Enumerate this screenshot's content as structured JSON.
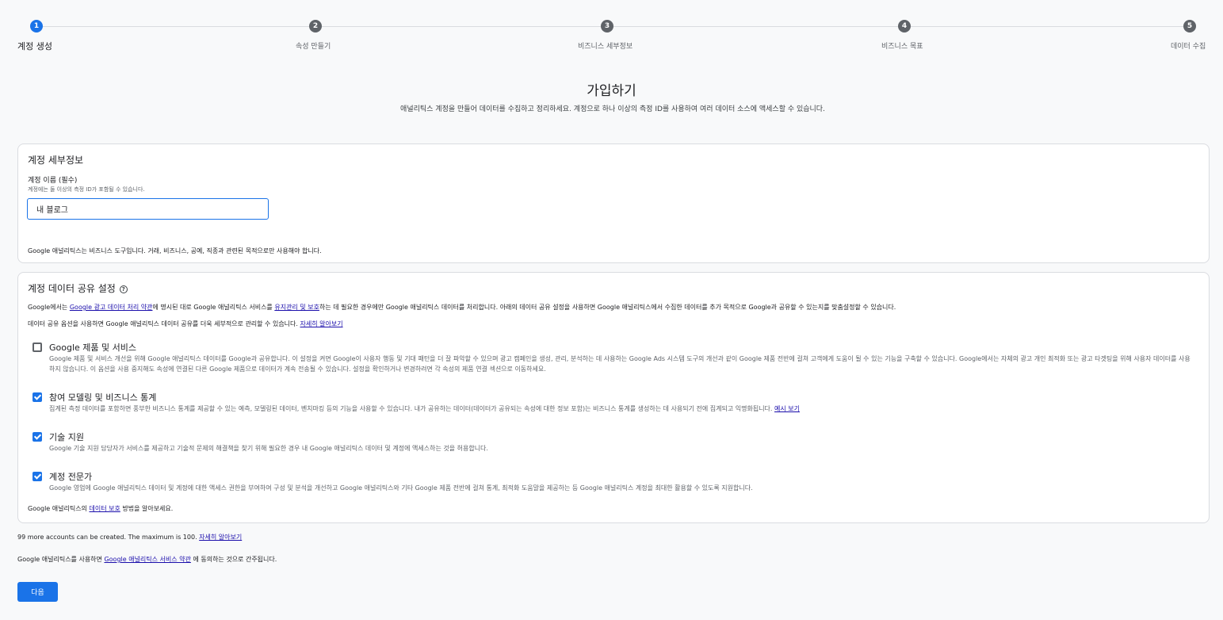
{
  "stepper": {
    "steps": [
      {
        "num": "1",
        "label": "계정 생성"
      },
      {
        "num": "2",
        "label": "속성 만들기"
      },
      {
        "num": "3",
        "label": "비즈니스 세부정보"
      },
      {
        "num": "4",
        "label": "비즈니스 목표"
      },
      {
        "num": "5",
        "label": "데이터 수집"
      }
    ],
    "active_step": 1
  },
  "header": {
    "title": "가입하기",
    "description": "애널리틱스 계정을 만들어 데이터를 수집하고 정리하세요. 계정으로 하나 이상의 측정 ID를 사용하여 여러 데이터 소스에 액세스할 수 있습니다."
  },
  "account_details": {
    "title": "계정 세부정보",
    "name_label": "계정 이름 (필수)",
    "name_help": "계정에는 둘 이상의 측정 ID가 포함될 수 있습니다.",
    "name_value": "내 블로그",
    "note": "Google 애널리틱스는 비즈니스 도구입니다. 거래, 비즈니스, 공예, 직종과 관련된 목적으로만 사용해야 합니다."
  },
  "sharing": {
    "title": "계정 데이터 공유 설정",
    "help_icon": "help-circle-icon",
    "intro_part1": "Google에서는 ",
    "intro_link1": "Google 광고 데이터 처리 약관",
    "intro_part2": "에 명시된 대로 Google 애널리틱스 서비스를 ",
    "intro_link2": "유지관리 및 보호",
    "intro_part3": "하는 데 필요한 경우에만 Google 애널리틱스 데이터를 처리합니다. 아래의 데이터 공유 설정을 사용하면 Google 애널리틱스에서 수집한 데이터를 추가 목적으로 Google과 공유할 수 있는지를 맞춤설정할 수 있습니다.",
    "manage_text": "데이터 공유 옵션을 사용하면 Google 애널리틱스 데이터 공유를 더욱 세부적으로 관리할 수 있습니다. ",
    "manage_link": "자세히 알아보기",
    "options": [
      {
        "title": "Google 제품 및 서비스",
        "checked": false,
        "desc": "Google 제품 및 서비스 개선을 위해 Google 애널리틱스 데이터를 Google과 공유합니다. 이 설정을 켜면 Google이 사용자 행동 및 기대 패턴을 더 잘 파악할 수 있으며 광고 캠페인을 생성, 관리, 분석하는 데 사용하는 Google Ads 시스템 도구의 개선과 같이 Google 제품 전반에 걸쳐 고객에게 도움이 될 수 있는 기능을 구축할 수 있습니다. Google에서는 자체의 광고 개인 최적화 또는 광고 타겟팅을 위해 사용자 데이터를 사용하지 않습니다. 이 옵션을 사용 중지해도 속성에 연결된 다른 Google 제품으로 데이터가 계속 전송될 수 있습니다. 설정을 확인하거나 변경하려면 각 속성의 제품 연결 섹션으로 이동하세요.",
        "link": ""
      },
      {
        "title": "참여 모델링 및 비즈니스 통계",
        "checked": true,
        "desc": "집계된 측정 데이터를 포함하면 풍부한 비즈니스 통계를 제공할 수 있는 예측, 모델링된 데이터, 벤치마킹 등의 기능을 사용할 수 있습니다. 내가 공유하는 데이터(데이터가 공유되는 속성에 대한 정보 포함)는 비즈니스 통계를 생성하는 데 사용되기 전에 집계되고 익명화됩니다. ",
        "link": "예시 보기"
      },
      {
        "title": "기술 지원",
        "checked": true,
        "desc": "Google 기술 지원 담당자가 서비스를 제공하고 기술적 문제의 해결책을 찾기 위해 필요한 경우 내 Google 애널리틱스 데이터 및 계정에 액세스하는 것을 허용합니다.",
        "link": ""
      },
      {
        "title": "계정 전문가",
        "checked": true,
        "desc": "Google 영업에 Google 애널리틱스 데이터 및 계정에 대한 액세스 권한을 부여하여 구성 및 분석을 개선하고 Google 애널리틱스와 기타 Google 제품 전반에 걸쳐 통계, 최적화 도움말을 제공하는 등 Google 애널리틱스 계정을 최대한 활용할 수 있도록 지원합니다.",
        "link": ""
      }
    ],
    "protection_part1": "Google 애널리틱스의 ",
    "protection_link": "데이터 보호",
    "protection_part2": " 방법을 알아보세요."
  },
  "footer": {
    "accounts_text": "99 more accounts can be created. The maximum is 100. ",
    "accounts_link": "자세히 알아보기",
    "terms_part1": "Google 애널리틱스를 사용하면 ",
    "terms_link": "Google 애널리틱스 서비스 약관",
    "terms_part2": " 에 동의하는 것으로 간주됩니다.",
    "next_label": "다음"
  },
  "colors": {
    "accent": "#1a73e8",
    "inactive_step": "#5f6368",
    "link": "#1a0dab"
  }
}
